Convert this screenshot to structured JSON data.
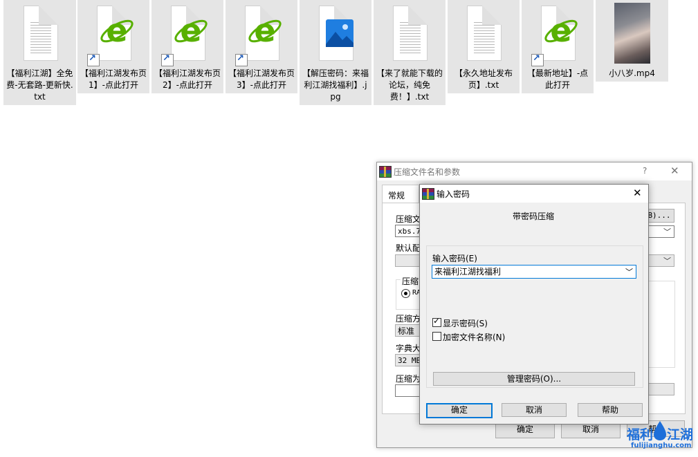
{
  "desktop": {
    "files": [
      {
        "label": "【福利江湖】全免费-无套路-更新快.txt",
        "icon": "text-file-icon",
        "shortcut": false,
        "selected": true
      },
      {
        "label": "【福利江湖发布页1】-点此打开",
        "icon": "ie-browser-icon",
        "shortcut": true,
        "selected": true
      },
      {
        "label": "【福利江湖发布页2】-点此打开",
        "icon": "ie-browser-icon",
        "shortcut": true,
        "selected": true
      },
      {
        "label": "【福利江湖发布页3】-点此打开",
        "icon": "ie-browser-icon",
        "shortcut": true,
        "selected": true
      },
      {
        "label": "【解压密码：来福利江湖找福利】.jpg",
        "icon": "image-file-icon",
        "shortcut": false,
        "selected": true
      },
      {
        "label": "【来了就能下载的论坛，纯免费！】.txt",
        "icon": "text-file-icon",
        "shortcut": false,
        "selected": true
      },
      {
        "label": "【永久地址发布页】.txt",
        "icon": "text-file-icon",
        "shortcut": false,
        "selected": true
      },
      {
        "label": "【最新地址】-点此打开",
        "icon": "ie-browser-icon",
        "shortcut": true,
        "selected": true
      },
      {
        "label": "小八岁.mp4",
        "icon": "video-thumbnail",
        "shortcut": false,
        "selected": true
      }
    ]
  },
  "archive_dialog": {
    "title": "压缩文件名和参数",
    "help_btn": "?",
    "close_btn": "✕",
    "tab_general": "常规",
    "archive_name_label": "压缩文",
    "archive_name_value": "xbs.7:",
    "browse_btn": "B)...",
    "default_profile_label": "默认配",
    "format_group": "压缩",
    "format_rar": "RA",
    "method_label": "压缩方",
    "method_value": "标准",
    "dict_label": "字典大",
    "dict_value": "32 MB",
    "split_label": "压缩为",
    "ok_btn": "确定",
    "cancel_btn": "取消",
    "help_btn2": "帮"
  },
  "password_dialog": {
    "title": "输入密码",
    "close_btn": "✕",
    "heading": "带密码压缩",
    "password_label": "输入密码(E)",
    "password_value": "来福利江湖找福利",
    "show_password_label": "显示密码(S)",
    "show_password_checked": true,
    "encrypt_names_label": "加密文件名称(N)",
    "encrypt_names_checked": false,
    "manage_btn": "管理密码(O)...",
    "ok_btn": "确定",
    "cancel_btn": "取消",
    "help_btn": "帮助"
  },
  "watermark": {
    "brand_left": "福利",
    "brand_right": "江湖",
    "domain": "fulijianghu.com"
  },
  "colors": {
    "tile_bg": "#e5e5e5",
    "ie_green": "#58b000",
    "default_border": "#0078d7",
    "watermark_blue": "#1e6fd9",
    "watermark_red": "#e02a2a"
  }
}
